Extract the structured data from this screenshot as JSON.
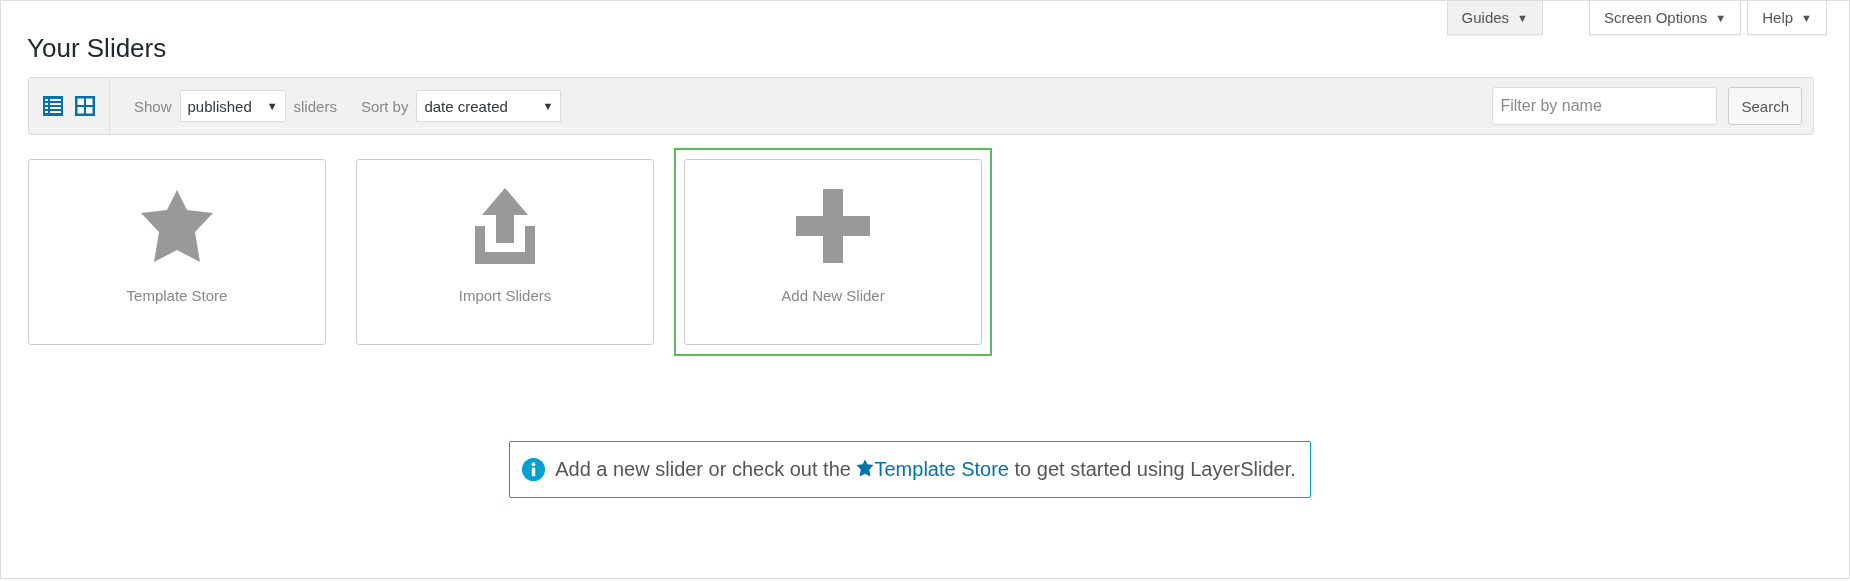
{
  "help_tabs": [
    {
      "label": "Guides",
      "caret": "▼",
      "active": true
    },
    {
      "label": "Screen Options",
      "caret": "▼",
      "active": false
    },
    {
      "label": "Help",
      "caret": "▼",
      "active": false
    }
  ],
  "title": "Your Sliders",
  "toolbar": {
    "show_label": "Show",
    "show_select": "published",
    "show_suffix": "sliders",
    "sort_label": "Sort by",
    "sort_select": "date created",
    "caret": "▼",
    "filter": {
      "placeholder": "Filter by name"
    },
    "search_button": "Search"
  },
  "cards": [
    {
      "kind": "star",
      "label": "Template Store",
      "highlighted": false
    },
    {
      "kind": "import",
      "label": "Import Sliders",
      "highlighted": false
    },
    {
      "kind": "plus",
      "label": "Add New Slider",
      "highlighted": true
    }
  ],
  "notice": {
    "before": "Add a new slider or check out the",
    "link": "Template Store",
    "after": "to get started using LayerSlider."
  }
}
